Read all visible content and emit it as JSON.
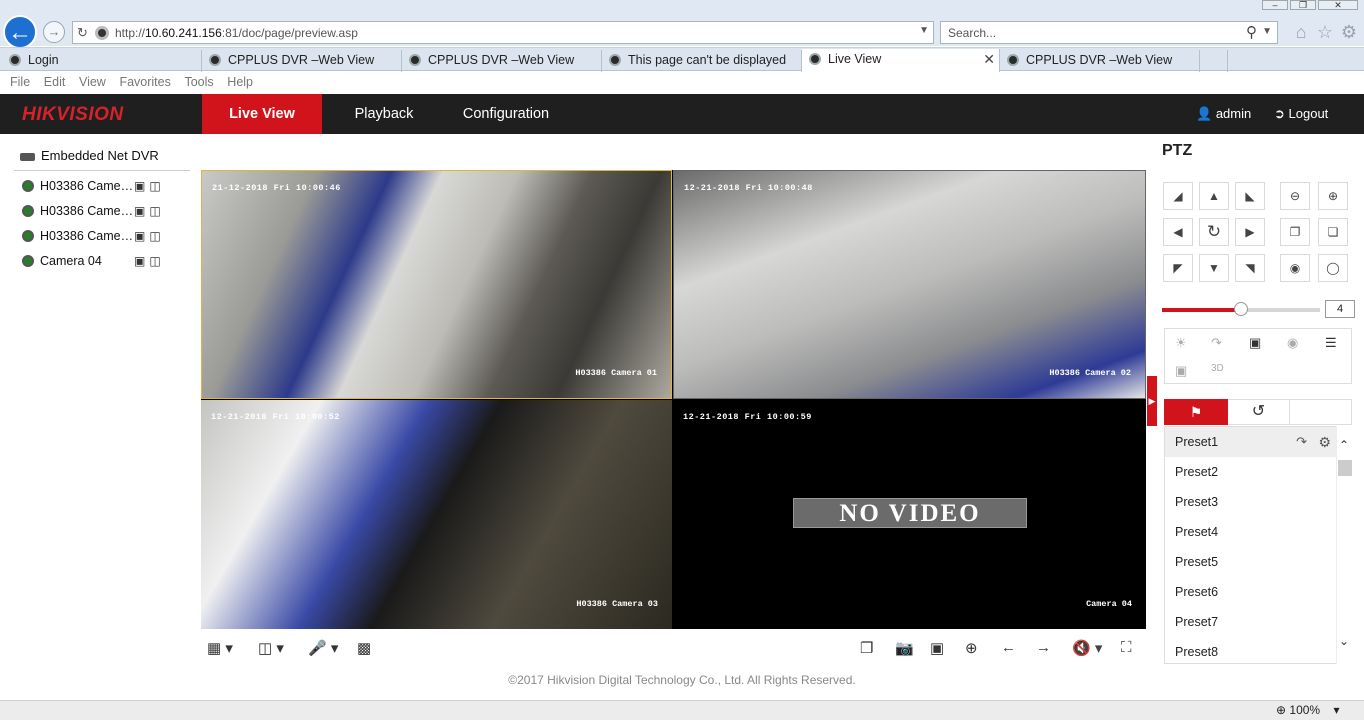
{
  "browser": {
    "address": {
      "prefix": "http://",
      "host": "10.60.241.156",
      "rest": ":81/doc/page/preview.asp"
    },
    "search_placeholder": "Search...",
    "tabs": [
      {
        "label": "Login",
        "active": false
      },
      {
        "label": "CPPLUS DVR –Web View",
        "active": false
      },
      {
        "label": "CPPLUS DVR –Web View",
        "active": false
      },
      {
        "label": "This page can't be displayed",
        "active": false
      },
      {
        "label": "Live View",
        "active": true
      },
      {
        "label": "CPPLUS DVR –Web View",
        "active": false
      }
    ],
    "menu": [
      "File",
      "Edit",
      "View",
      "Favorites",
      "Tools",
      "Help"
    ],
    "zoom": "100%"
  },
  "app": {
    "logo": "HIKVISION",
    "nav": {
      "live": "Live View",
      "playback": "Playback",
      "config": "Configuration"
    },
    "user": "admin",
    "logout": "Logout",
    "device": "Embedded Net DVR",
    "cameras": [
      "H03386 Came…",
      "H03386 Came…",
      "H03386 Came…",
      "Camera 04"
    ],
    "video": [
      {
        "timestamp": "21-12-2018 Fri 10:00:46",
        "name": "H03386 Camera 01"
      },
      {
        "timestamp": "12-21-2018 Fri 10:00:48",
        "name": "H03386 Camera 02"
      },
      {
        "timestamp": "12-21-2018 Fri 10:00:52",
        "name": "H03386 Camera 03"
      },
      {
        "timestamp": "12-21-2018 Fri 10:00:59",
        "name": "Camera 04"
      }
    ],
    "no_video": "NO VIDEO",
    "copyright": "©2017 Hikvision Digital Technology Co., Ltd. All Rights Reserved.",
    "ptz": {
      "title": "PTZ",
      "speed": "4",
      "speed_fraction": 0.5,
      "presets": [
        "Preset1",
        "Preset2",
        "Preset3",
        "Preset4",
        "Preset5",
        "Preset6",
        "Preset7",
        "Preset8"
      ]
    }
  },
  "colors": {
    "accent": "#d1141c",
    "appbar": "#1f1f1f"
  }
}
